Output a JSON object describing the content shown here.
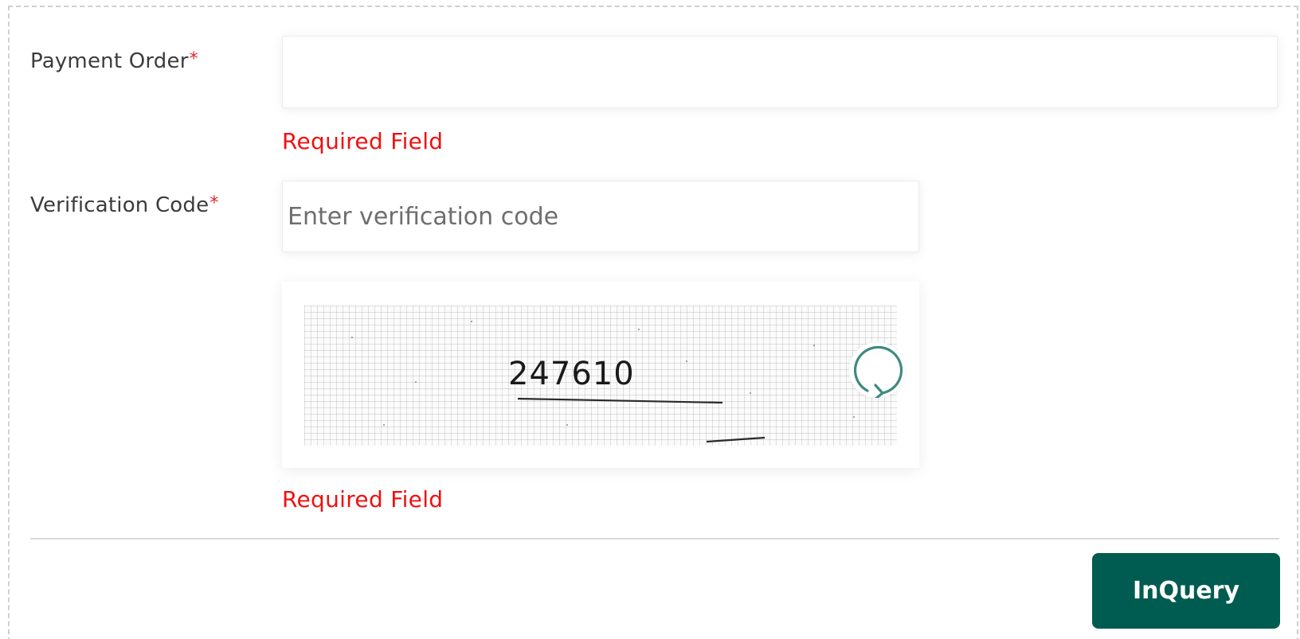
{
  "form": {
    "payment_order": {
      "label": "Payment Order",
      "required_mark": "*",
      "value": "",
      "placeholder": "",
      "error": "Required Field"
    },
    "verification_code": {
      "label": "Verification Code",
      "required_mark": "*",
      "value": "",
      "placeholder": "Enter verification code",
      "error": "Required Field"
    },
    "captcha": {
      "text": "247610",
      "refresh_icon": "refresh-icon"
    },
    "submit_label": "InQuery"
  },
  "colors": {
    "accent": "#005c50",
    "error": "#ee1111",
    "required": "#e0262f",
    "refresh_icon": "#3f8a82"
  }
}
